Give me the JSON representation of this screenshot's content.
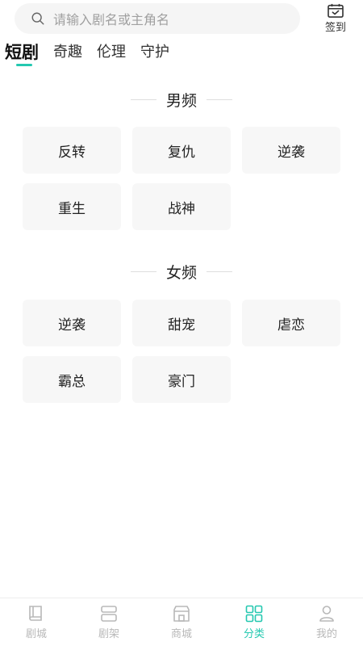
{
  "search": {
    "placeholder": "请输入剧名或主角名"
  },
  "signin": {
    "label": "签到"
  },
  "tabs": [
    {
      "label": "短剧",
      "active": true
    },
    {
      "label": "奇趣",
      "active": false
    },
    {
      "label": "伦理",
      "active": false
    },
    {
      "label": "守护",
      "active": false
    }
  ],
  "sections": [
    {
      "title": "男频",
      "items": [
        "反转",
        "复仇",
        "逆袭",
        "重生",
        "战神"
      ]
    },
    {
      "title": "女频",
      "items": [
        "逆袭",
        "甜宠",
        "虐恋",
        "霸总",
        "豪门"
      ]
    }
  ],
  "bottom_nav": [
    {
      "label": "剧城",
      "icon": "book-icon",
      "active": false
    },
    {
      "label": "剧架",
      "icon": "shelf-icon",
      "active": false
    },
    {
      "label": "商城",
      "icon": "store-icon",
      "active": false
    },
    {
      "label": "分类",
      "icon": "grid-icon",
      "active": true
    },
    {
      "label": "我的",
      "icon": "user-icon",
      "active": false
    }
  ],
  "colors": {
    "accent": "#24c8b0",
    "inactive": "#b8b8b8",
    "chip_bg": "#f7f7f7"
  }
}
